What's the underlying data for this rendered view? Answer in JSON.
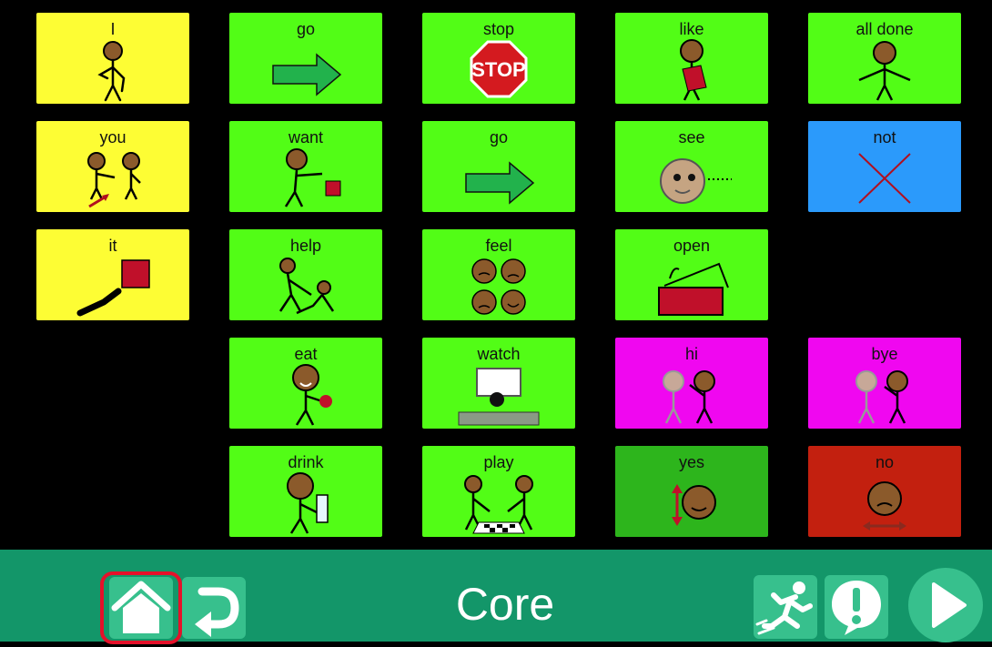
{
  "tiles": [
    {
      "id": "i",
      "label": "I",
      "color": "yellow",
      "col": 0,
      "row": 0,
      "icon": "person-pointing-self-icon"
    },
    {
      "id": "you",
      "label": "you",
      "color": "yellow",
      "col": 0,
      "row": 1,
      "icon": "two-people-pointing-icon"
    },
    {
      "id": "it",
      "label": "it",
      "color": "yellow",
      "col": 0,
      "row": 2,
      "icon": "hand-pointing-square-icon"
    },
    {
      "id": "go-1",
      "label": "go",
      "color": "green",
      "col": 1,
      "row": 0,
      "icon": "arrow-right-icon"
    },
    {
      "id": "want",
      "label": "want",
      "color": "green",
      "col": 1,
      "row": 1,
      "icon": "person-reaching-icon"
    },
    {
      "id": "help",
      "label": "help",
      "color": "green",
      "col": 1,
      "row": 2,
      "icon": "person-helping-icon"
    },
    {
      "id": "eat",
      "label": "eat",
      "color": "green",
      "col": 1,
      "row": 3,
      "icon": "person-eating-apple-icon"
    },
    {
      "id": "drink",
      "label": "drink",
      "color": "green",
      "col": 1,
      "row": 4,
      "icon": "person-drinking-icon"
    },
    {
      "id": "stop",
      "label": "stop",
      "color": "green",
      "col": 2,
      "row": 0,
      "icon": "stop-sign-icon"
    },
    {
      "id": "go-2",
      "label": "go",
      "color": "green",
      "col": 2,
      "row": 1,
      "icon": "arrow-right-icon"
    },
    {
      "id": "feel",
      "label": "feel",
      "color": "green",
      "col": 2,
      "row": 2,
      "icon": "four-faces-icon"
    },
    {
      "id": "watch",
      "label": "watch",
      "color": "green",
      "col": 2,
      "row": 3,
      "icon": "person-watching-screen-icon"
    },
    {
      "id": "play",
      "label": "play",
      "color": "green",
      "col": 2,
      "row": 4,
      "icon": "two-people-playing-icon"
    },
    {
      "id": "like",
      "label": "like",
      "color": "green",
      "col": 3,
      "row": 0,
      "icon": "person-heart-icon"
    },
    {
      "id": "see",
      "label": "see",
      "color": "green",
      "col": 3,
      "row": 1,
      "icon": "face-looking-icon"
    },
    {
      "id": "open",
      "label": "open",
      "color": "green",
      "col": 3,
      "row": 2,
      "icon": "box-open-icon"
    },
    {
      "id": "hi",
      "label": "hi",
      "color": "magenta",
      "col": 3,
      "row": 3,
      "icon": "person-waving-icon"
    },
    {
      "id": "yes",
      "label": "yes",
      "color": "dgreen",
      "col": 3,
      "row": 4,
      "icon": "face-nodding-icon"
    },
    {
      "id": "all-done",
      "label": "all done",
      "color": "green",
      "col": 4,
      "row": 0,
      "icon": "person-hands-open-icon"
    },
    {
      "id": "not",
      "label": "not",
      "color": "blue",
      "col": 4,
      "row": 1,
      "icon": "cross-icon"
    },
    {
      "id": "bye",
      "label": "bye",
      "color": "magenta",
      "col": 4,
      "row": 3,
      "icon": "person-waving-bye-icon"
    },
    {
      "id": "no",
      "label": "no",
      "color": "red",
      "col": 4,
      "row": 4,
      "icon": "face-shaking-icon"
    }
  ],
  "toolbar": {
    "title": "Core",
    "home_icon": "home-icon",
    "back_icon": "return-arrow-icon",
    "quickfires_icon": "running-person-icon",
    "alert_icon": "exclamation-bubble-icon",
    "speak_icon": "play-icon"
  },
  "colors": {
    "toolbar_bg": "#139669",
    "button_bg": "#37c08d",
    "highlight_ring": "#e5112a"
  }
}
